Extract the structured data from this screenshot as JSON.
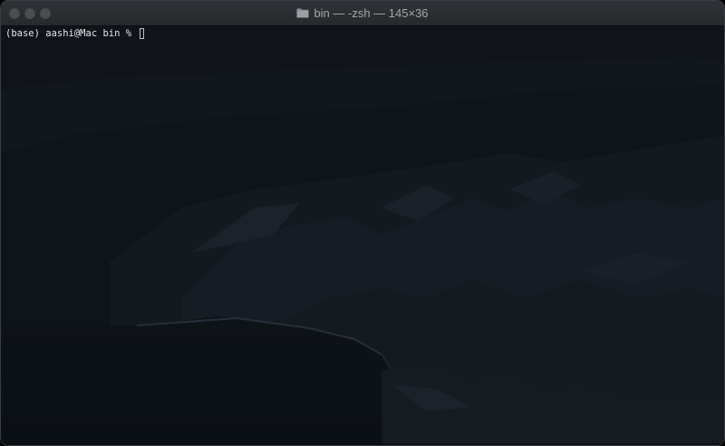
{
  "window": {
    "title": "bin — -zsh — 145×36",
    "title_icon": "folder-icon"
  },
  "terminal": {
    "prompt": "(base) aashi@Mac bin % ",
    "input": ""
  },
  "colors": {
    "titlebar": "#2b2d31",
    "background": "#0d1014",
    "text": "#e8e8e8"
  }
}
